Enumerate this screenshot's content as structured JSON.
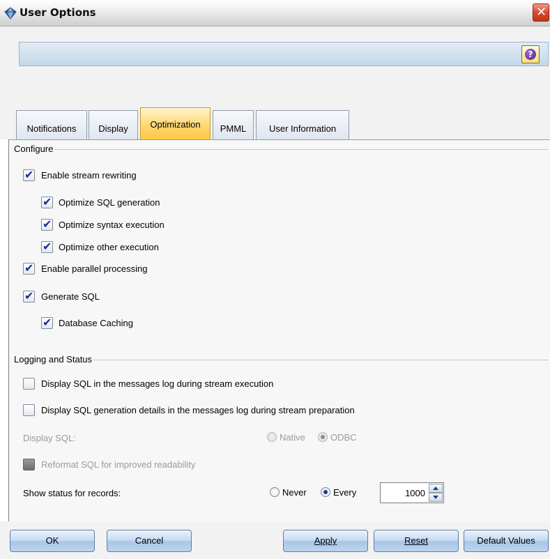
{
  "window": {
    "title": "User Options",
    "close_glyph": "✕",
    "icon": "diamond-icon"
  },
  "toolbar": {
    "help_glyph": "?",
    "help_icon": "help-icon"
  },
  "tabs": [
    {
      "label": "Notifications",
      "active": false
    },
    {
      "label": "Display",
      "active": false
    },
    {
      "label": "Optimization",
      "active": true
    },
    {
      "label": "PMML",
      "active": false
    },
    {
      "label": "User Information",
      "active": false
    }
  ],
  "configure": {
    "title": "Configure",
    "enable_stream_rewriting": {
      "label": "Enable stream rewriting",
      "checked": true
    },
    "optimize_sql_generation": {
      "label": "Optimize SQL generation",
      "checked": true
    },
    "optimize_syntax_execution": {
      "label": "Optimize syntax execution",
      "checked": true
    },
    "optimize_other_execution": {
      "label": "Optimize other execution",
      "checked": true
    },
    "enable_parallel_processing": {
      "label": "Enable parallel processing",
      "checked": true
    },
    "generate_sql": {
      "label": "Generate SQL",
      "checked": true
    },
    "database_caching": {
      "label": "Database Caching",
      "checked": true
    }
  },
  "logging": {
    "title": "Logging and Status",
    "display_sql_in_log": {
      "label": "Display SQL in the messages log during stream execution",
      "checked": false
    },
    "display_sql_generation_details": {
      "label": "Display SQL generation details in the messages log during stream preparation",
      "checked": false
    },
    "display_sql": {
      "label": "Display SQL:",
      "options": [
        "Native",
        "ODBC"
      ],
      "selected": "ODBC",
      "disabled": true
    },
    "reformat_sql": {
      "label": "Reformat SQL for improved readability",
      "disabled": true
    },
    "show_status": {
      "label": "Show status for records:",
      "options": [
        "Never",
        "Every"
      ],
      "selected": "Every",
      "value": "1000"
    }
  },
  "buttons": {
    "ok": "OK",
    "cancel": "Cancel",
    "apply": "Apply",
    "reset": "Reset",
    "default_values": "Default Values"
  },
  "colors": {
    "active_tab": "#ffd46a",
    "button_blue": "#a9c6e8",
    "checkmark": "#1e2b9c"
  }
}
